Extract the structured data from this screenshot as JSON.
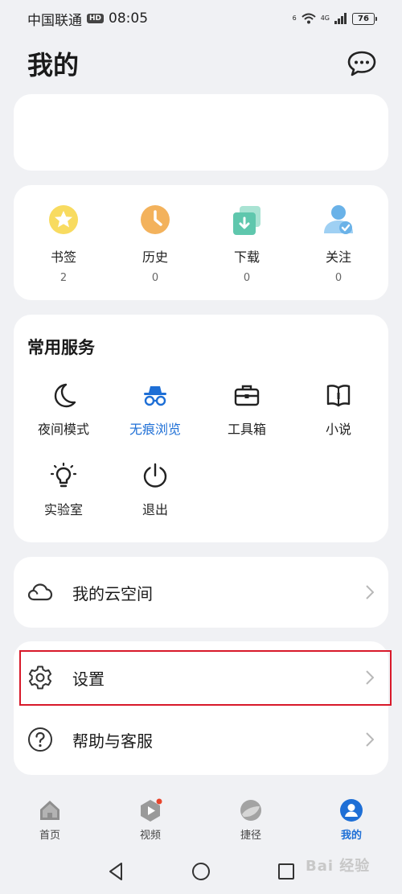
{
  "status_bar": {
    "carrier": "中国联通",
    "hd": "HD",
    "time": "08:05",
    "signal_tag": "6",
    "net_tag": "4G",
    "battery": "76"
  },
  "header": {
    "title": "我的"
  },
  "stats": [
    {
      "label": "书签",
      "count": "2",
      "icon": "star-icon",
      "color": "#f7d64a"
    },
    {
      "label": "历史",
      "count": "0",
      "icon": "clock-icon",
      "color": "#f3b25c"
    },
    {
      "label": "下载",
      "count": "0",
      "icon": "download-icon",
      "color": "#5fc7ad"
    },
    {
      "label": "关注",
      "count": "0",
      "icon": "user-follow-icon",
      "color": "#6ab2e8"
    }
  ],
  "services": {
    "title": "常用服务",
    "items": [
      {
        "label": "夜间模式",
        "icon": "moon-icon"
      },
      {
        "label": "无痕浏览",
        "icon": "incognito-icon",
        "active": true
      },
      {
        "label": "工具箱",
        "icon": "toolbox-icon"
      },
      {
        "label": "小说",
        "icon": "book-icon"
      },
      {
        "label": "实验室",
        "icon": "lightbulb-icon"
      },
      {
        "label": "退出",
        "icon": "power-icon"
      }
    ]
  },
  "cloud": {
    "label": "我的云空间"
  },
  "settings_list": [
    {
      "label": "设置",
      "icon": "gear-icon"
    },
    {
      "label": "帮助与客服",
      "icon": "help-icon"
    }
  ],
  "bottom_nav": [
    {
      "label": "首页",
      "icon": "home-icon"
    },
    {
      "label": "视频",
      "icon": "video-icon"
    },
    {
      "label": "捷径",
      "icon": "shortcut-icon"
    },
    {
      "label": "我的",
      "icon": "profile-icon",
      "active": true
    }
  ],
  "accent_color": "#1e6fd6",
  "highlight_color": "#d8192a",
  "watermark": "Bai 经验"
}
